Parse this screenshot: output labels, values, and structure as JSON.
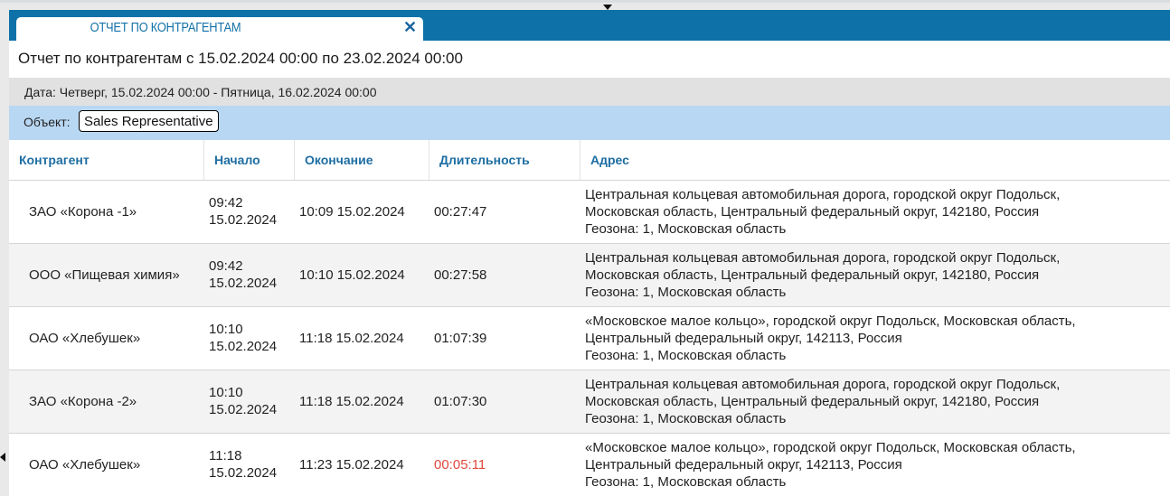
{
  "tab": {
    "title": "ОТЧЕТ ПО КОНТРАГЕНТАМ",
    "close_glyph": "✕"
  },
  "report": {
    "title": "Отчет по контрагентам с 15.02.2024 00:00 по 23.02.2024 00:00",
    "date_line": "Дата: Четверг, 15.02.2024 00:00 - Пятница, 16.02.2024 00:00",
    "object_label": "Объект:",
    "object_value": "Sales Representative"
  },
  "table": {
    "columns": [
      "Контрагент",
      "Начало",
      "Окончание",
      "Длительность",
      "Адрес"
    ],
    "rows": [
      {
        "name": "ЗАО «Корона -1»",
        "start_time": "09:42",
        "start_date": "15.02.2024",
        "end": "10:09 15.02.2024",
        "duration": "00:27:47",
        "duration_color": "#222222",
        "addr1": "Центральная кольцевая автомобильная дорога, городской округ Подольск,",
        "addr2": "Московская область, Центральный федеральный округ, 142180, Россия",
        "addr3": "Геозона: 1, Московская область"
      },
      {
        "name": "ООО «Пищевая химия»",
        "start_time": "09:42",
        "start_date": "15.02.2024",
        "end": "10:10 15.02.2024",
        "duration": "00:27:58",
        "duration_color": "#222222",
        "addr1": "Центральная кольцевая автомобильная дорога, городской округ Подольск,",
        "addr2": "Московская область, Центральный федеральный округ, 142180, Россия",
        "addr3": "Геозона: 1, Московская область"
      },
      {
        "name": "ОАО «Хлебушек»",
        "start_time": "10:10",
        "start_date": "15.02.2024",
        "end": "11:18 15.02.2024",
        "duration": "01:07:39",
        "duration_color": "#222222",
        "addr1": "«Московское малое кольцо», городской округ Подольск, Московская область,",
        "addr2": "Центральный федеральный округ, 142113, Россия",
        "addr3": "Геозона: 1, Московская область"
      },
      {
        "name": "ЗАО «Корона -2»",
        "start_time": "10:10",
        "start_date": "15.02.2024",
        "end": "11:18 15.02.2024",
        "duration": "01:07:30",
        "duration_color": "#222222",
        "addr1": "Центральная кольцевая автомобильная дорога, городской округ Подольск,",
        "addr2": "Московская область, Центральный федеральный округ, 142180, Россия",
        "addr3": "Геозона: 1, Московская область"
      },
      {
        "name": "ОАО «Хлебушек»",
        "start_time": "11:18",
        "start_date": "15.02.2024",
        "end": "11:23 15.02.2024",
        "duration": "00:05:11",
        "duration_color": "#e0483c",
        "addr1": "«Московское малое кольцо», городской округ Подольск, Московская область,",
        "addr2": "Центральный федеральный округ, 142113, Россия",
        "addr3": "Геозона: 1, Московская область"
      }
    ]
  },
  "icons": {
    "collapse": "caret-down-icon",
    "side": "caret-left-icon",
    "close": "close-icon"
  }
}
